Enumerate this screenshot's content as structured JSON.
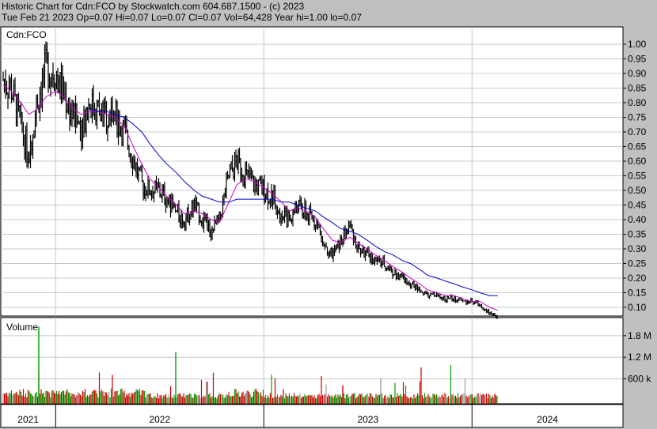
{
  "header": {
    "line1": "Historic Chart for Cdn:FCO by Stockwatch.com 604.687.1500 - (c) 2023",
    "line2": "Tue Feb 21 2023  Op=0.07  Hi=0.07  Lo=0.07  Cl=0.07  Vol=64,428  Year hi=1.00  lo=0.07"
  },
  "colors": {
    "background": "#c0c0c0",
    "panel": "#ffffff",
    "price_bar": "#000000",
    "ma_short": "#cc00cc",
    "ma_long": "#0000cc",
    "volume_up": "#00a000",
    "volume_down": "#d00000",
    "volume_flat": "#a0a0a0"
  },
  "chart_data": [
    {
      "type": "line",
      "panel": "price",
      "title": "Cdn:FCO",
      "y_ticks": [
        "1.00",
        "0.95",
        "0.90",
        "0.85",
        "0.80",
        "0.75",
        "0.70",
        "0.65",
        "0.60",
        "0.55",
        "0.50",
        "0.45",
        "0.40",
        "0.35",
        "0.30",
        "0.25",
        "0.20",
        "0.15",
        "0.10"
      ],
      "ylim": [
        0.05,
        1.03
      ],
      "x_labels": [
        "2021",
        "2022",
        "2023",
        "2024"
      ],
      "grid": true,
      "series": [
        {
          "kind": "close",
          "x": [
            "2020-10-01",
            "2020-10-15",
            "2020-11-01",
            "2020-11-15",
            "2020-12-01",
            "2020-12-15",
            "2021-01-01",
            "2021-01-15",
            "2021-02-01",
            "2021-02-15",
            "2021-03-01",
            "2021-03-15",
            "2021-04-01",
            "2021-04-15",
            "2021-05-01",
            "2021-05-15",
            "2021-06-01",
            "2021-06-15",
            "2021-07-01",
            "2021-07-15",
            "2021-08-01",
            "2021-08-15",
            "2021-09-01",
            "2021-09-15",
            "2021-10-01",
            "2021-10-15",
            "2021-11-01",
            "2021-11-15",
            "2021-12-01",
            "2021-12-15",
            "2022-01-01",
            "2022-01-15",
            "2022-02-01",
            "2022-02-15",
            "2022-03-01",
            "2022-03-15",
            "2022-04-01",
            "2022-04-15",
            "2022-05-01",
            "2022-05-15",
            "2022-06-01",
            "2022-06-15",
            "2022-07-01",
            "2022-07-15",
            "2022-08-01",
            "2022-08-15",
            "2022-09-01",
            "2022-09-15",
            "2022-10-01",
            "2022-10-15",
            "2022-11-01",
            "2022-11-15",
            "2022-12-01",
            "2022-12-15",
            "2023-01-01",
            "2023-01-15",
            "2023-02-01",
            "2023-02-15"
          ],
          "values": [
            0.88,
            0.85,
            0.72,
            0.62,
            0.82,
            0.92,
            0.9,
            0.83,
            0.75,
            0.72,
            0.8,
            0.78,
            0.75,
            0.76,
            0.7,
            0.62,
            0.52,
            0.5,
            0.5,
            0.47,
            0.42,
            0.4,
            0.45,
            0.4,
            0.36,
            0.4,
            0.55,
            0.6,
            0.55,
            0.52,
            0.5,
            0.48,
            0.42,
            0.4,
            0.45,
            0.42,
            0.4,
            0.33,
            0.28,
            0.32,
            0.38,
            0.3,
            0.28,
            0.26,
            0.25,
            0.22,
            0.2,
            0.18,
            0.16,
            0.14,
            0.14,
            0.13,
            0.13,
            0.12,
            0.12,
            0.11,
            0.08,
            0.07
          ]
        },
        {
          "kind": "moving_average_short",
          "values": [
            0.86,
            0.84,
            0.8,
            0.76,
            0.78,
            0.82,
            0.84,
            0.82,
            0.78,
            0.76,
            0.77,
            0.77,
            0.76,
            0.75,
            0.72,
            0.66,
            0.59,
            0.54,
            0.51,
            0.48,
            0.45,
            0.42,
            0.43,
            0.42,
            0.4,
            0.39,
            0.46,
            0.52,
            0.54,
            0.53,
            0.51,
            0.49,
            0.46,
            0.43,
            0.44,
            0.43,
            0.41,
            0.37,
            0.33,
            0.32,
            0.34,
            0.32,
            0.3,
            0.28,
            0.26,
            0.24,
            0.22,
            0.2,
            0.18,
            0.16,
            0.15,
            0.14,
            0.14,
            0.13,
            0.12,
            0.12,
            0.1,
            0.09
          ]
        },
        {
          "kind": "moving_average_long",
          "values": [
            null,
            null,
            null,
            null,
            null,
            null,
            null,
            null,
            null,
            null,
            0.78,
            0.77,
            0.77,
            0.76,
            0.75,
            0.73,
            0.7,
            0.66,
            0.62,
            0.59,
            0.56,
            0.53,
            0.5,
            0.48,
            0.47,
            0.46,
            0.46,
            0.47,
            0.47,
            0.47,
            0.47,
            0.47,
            0.46,
            0.46,
            0.45,
            0.44,
            0.43,
            0.41,
            0.39,
            0.37,
            0.36,
            0.35,
            0.33,
            0.31,
            0.29,
            0.28,
            0.26,
            0.25,
            0.23,
            0.21,
            0.2,
            0.19,
            0.18,
            0.17,
            0.16,
            0.15,
            0.14,
            0.14
          ]
        }
      ]
    },
    {
      "type": "bar",
      "panel": "volume",
      "title": "Volume",
      "y_ticks": [
        "1.8 M",
        "1.2 M",
        "600 k"
      ],
      "ylim": [
        0,
        2300000
      ],
      "x_labels": [
        "2021",
        "2022",
        "2023",
        "2024"
      ]
    }
  ]
}
